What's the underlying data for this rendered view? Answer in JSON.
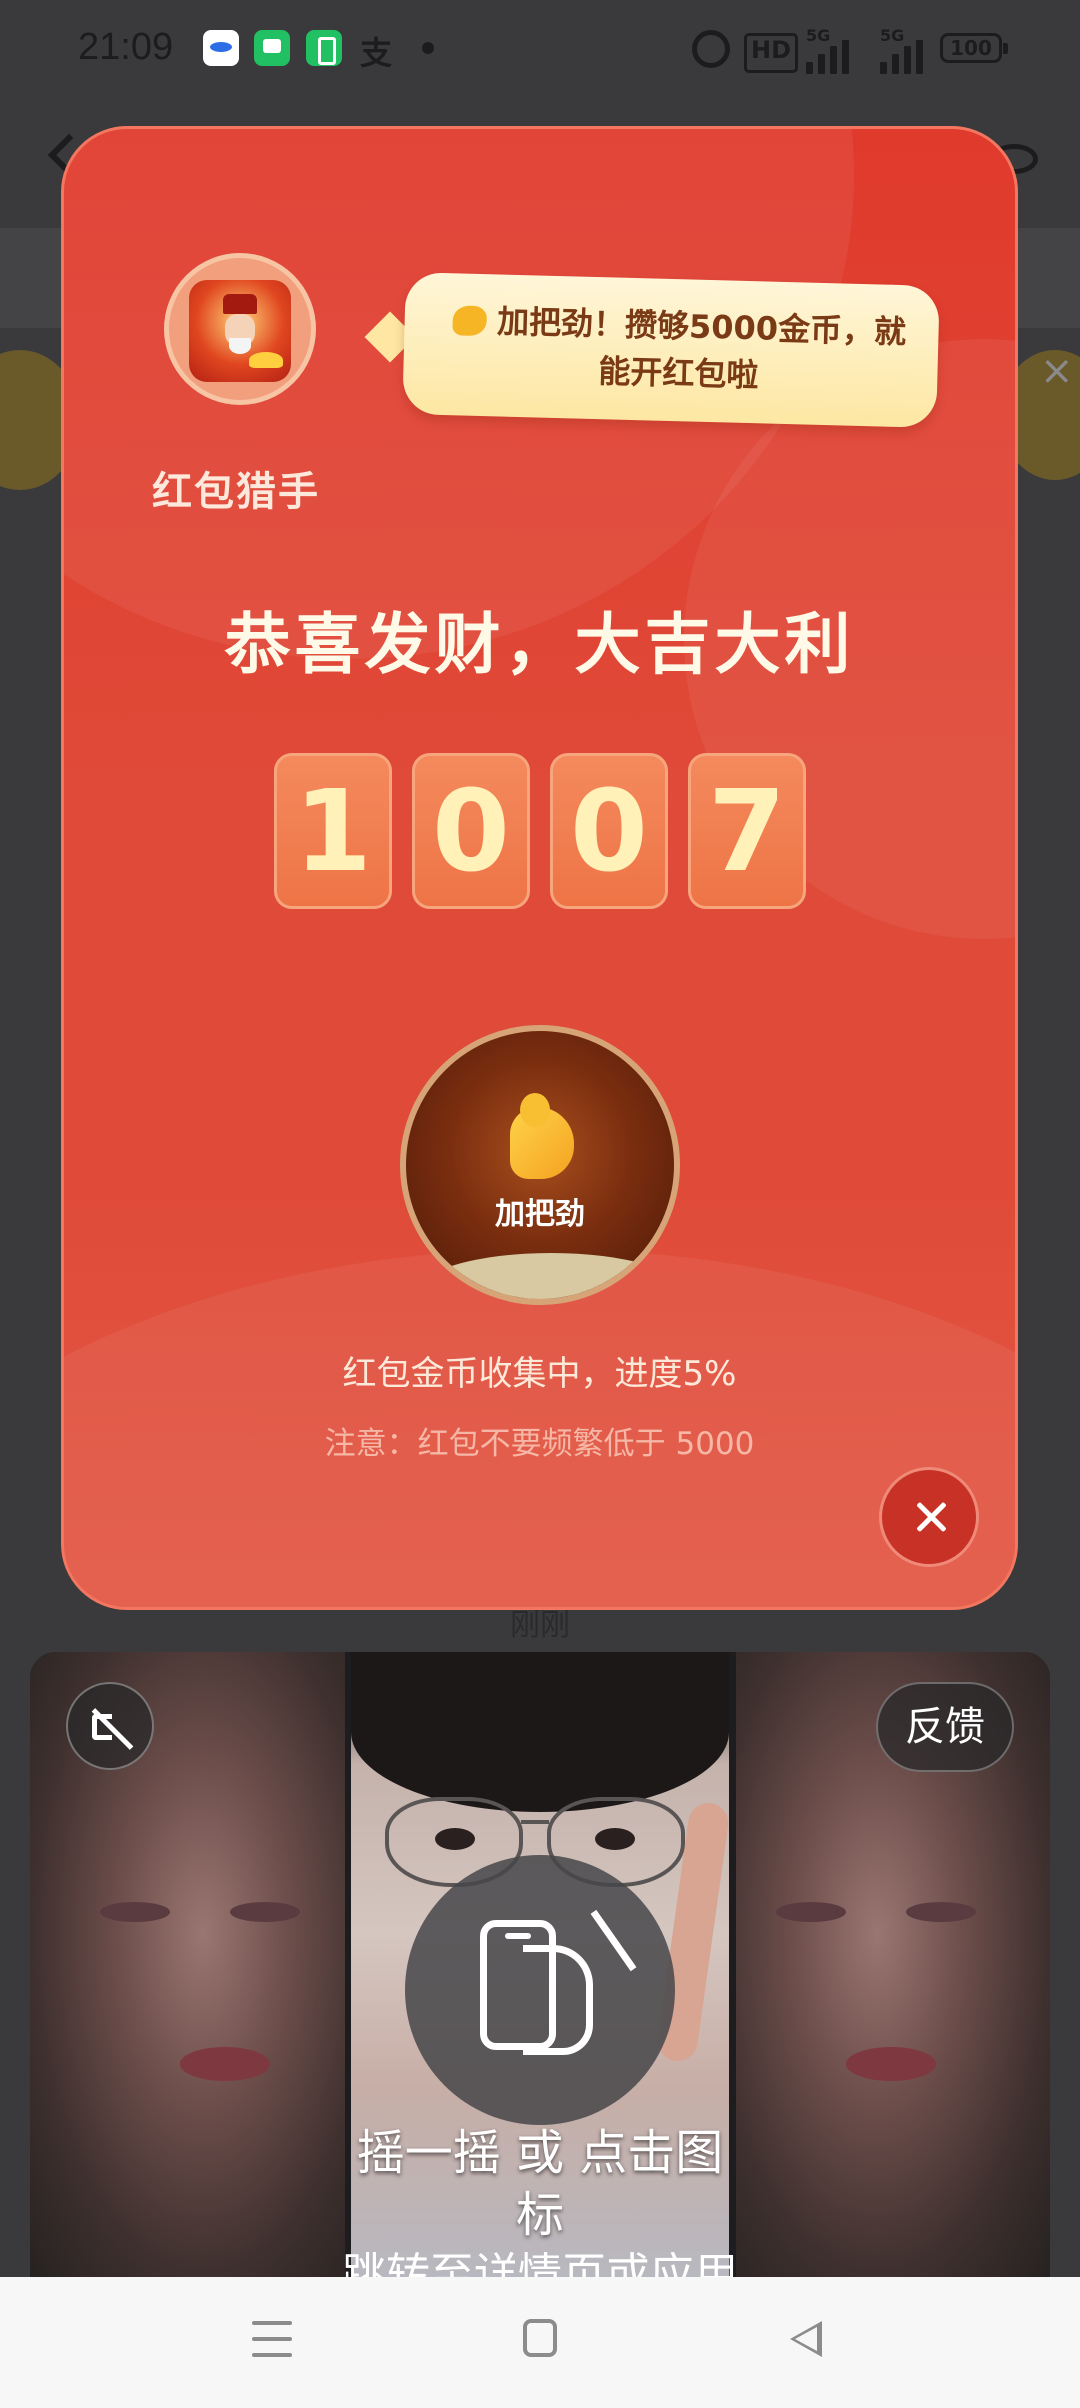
{
  "status_bar": {
    "time": "21:09",
    "notifications": [
      "weibo-icon",
      "messages-icon",
      "battery-app-icon",
      "alipay-icon"
    ],
    "alipay_glyph": "支",
    "hd_label": "HD",
    "signal_1_label": "5G",
    "signal_2_label": "5G",
    "battery": "100"
  },
  "background": {
    "caption": "刚刚"
  },
  "modal": {
    "avatar_name": "红包猎手",
    "bubble_text": "加把劲！攒够5000金币，就能开红包啦",
    "headline": "恭喜发财，大吉大利",
    "digits": [
      "1",
      "0",
      "0",
      "7"
    ],
    "boost_label": "加把劲",
    "progress_text": "红包金币收集中，进度5%",
    "notice_text": "注意：红包不要频繁低于 5000",
    "colors": {
      "background": "#e04a38",
      "bubble": "#fde7a3",
      "digit_text": "#fff1b8"
    }
  },
  "video_ad": {
    "feedback_label": "反馈",
    "shake_text": "摇一摇 或 点击图标",
    "shake_subtext": "跳转至详情页或应用"
  },
  "nav_bar": {
    "items": [
      "menu-icon",
      "home-icon",
      "back-icon"
    ]
  }
}
